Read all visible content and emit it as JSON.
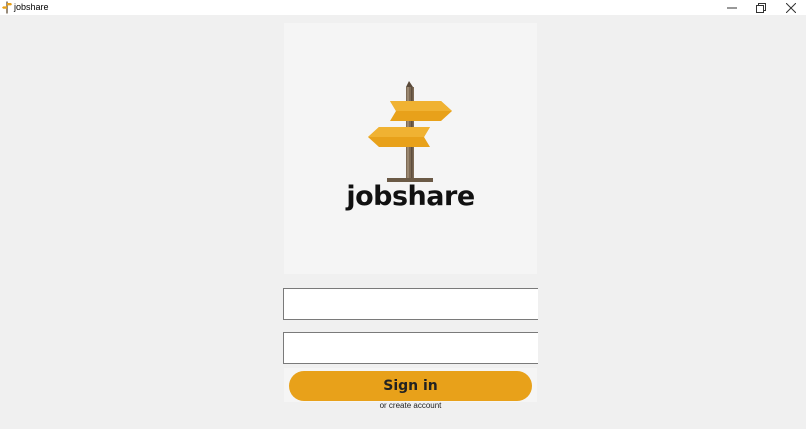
{
  "window": {
    "title": "jobshare",
    "minimize_icon": "minimize-icon",
    "maximize_icon": "restore-icon",
    "close_icon": "close-icon"
  },
  "logo": {
    "text": "jobshare",
    "icon": "signpost-icon"
  },
  "form": {
    "username_value": "",
    "password_value": "",
    "signin_label": "Sign in",
    "create_account_label": "or create account"
  },
  "colors": {
    "accent": "#e8a11a",
    "background": "#f0f0f0",
    "panel": "#f5f5f5"
  }
}
